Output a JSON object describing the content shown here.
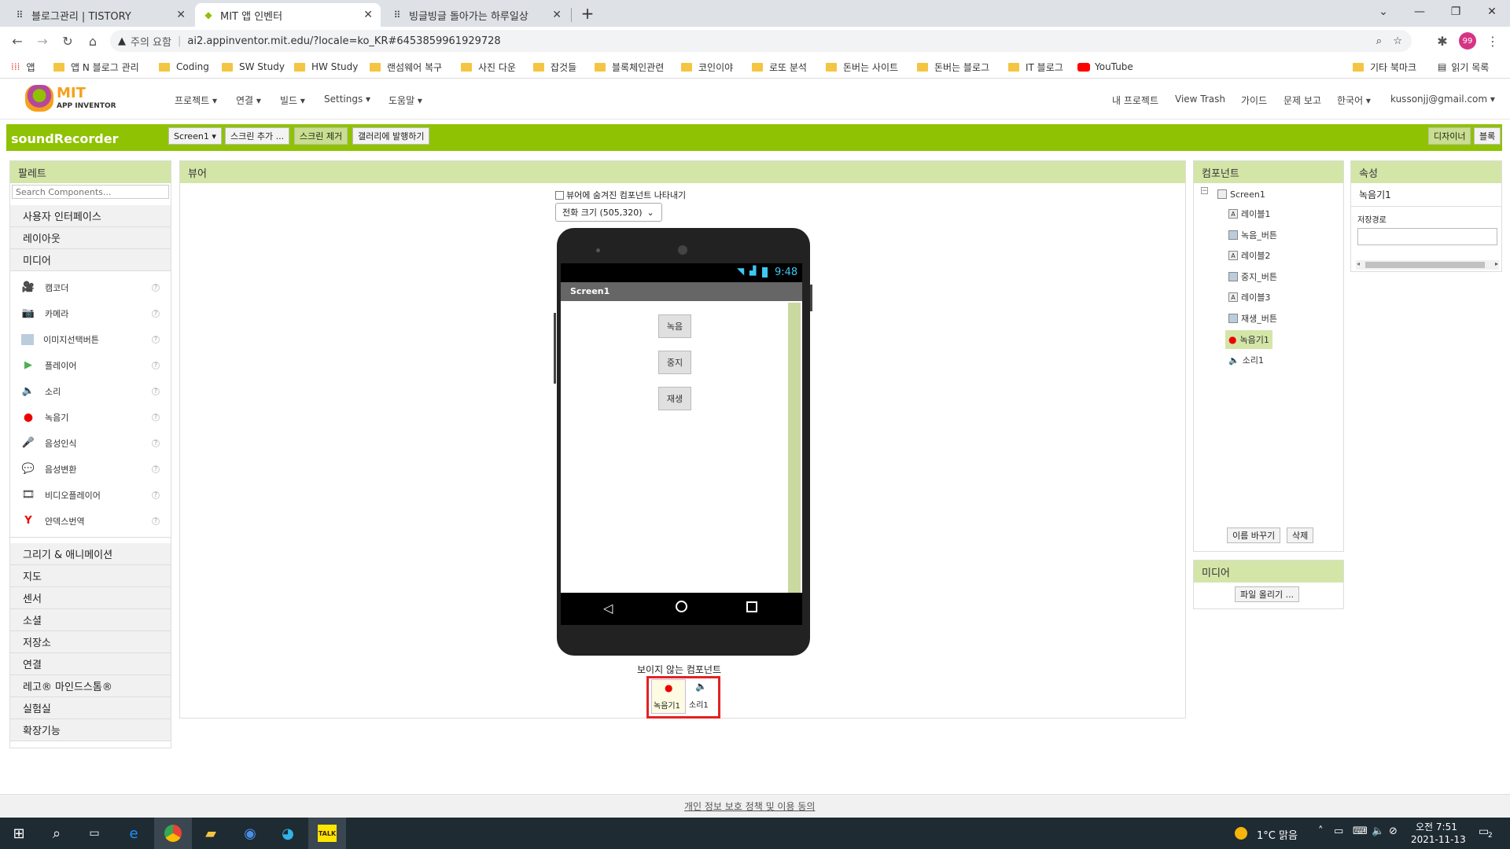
{
  "browser": {
    "tabs": [
      {
        "title": "블로그관리 | TISTORY",
        "active": false
      },
      {
        "title": "MIT 앱 인벤터",
        "active": true
      },
      {
        "title": "빙글빙글 돌아가는 하루일상",
        "active": false
      }
    ],
    "security_label": "주의 요함",
    "url": "ai2.appinventor.mit.edu/?locale=ko_KR#6453859961929728",
    "profile_initials": "99",
    "bookmarks": [
      "앱",
      "앱 N 블로그 관리",
      "Coding",
      "SW Study",
      "HW Study",
      "랜섬웨어 복구",
      "사진 다운",
      "잡것들",
      "블록체인관련",
      "코인이야",
      "로또 분석",
      "돈버는 사이트",
      "돈버는 블로그",
      "IT 블로그",
      "YouTube"
    ],
    "bookmarks_right": [
      "기타 북마크",
      "읽기 목록"
    ]
  },
  "app": {
    "logo_title": "MIT",
    "logo_sub": "APP INVENTOR",
    "menus": [
      "프로젝트 ▾",
      "연결 ▾",
      "빌드 ▾",
      "Settings ▾",
      "도움말 ▾"
    ],
    "right_menus": [
      "내 프로젝트",
      "View Trash",
      "가이드",
      "문제 보고",
      "한국어 ▾",
      "kussonjj@gmail.com ▾"
    ],
    "project_name": "soundRecorder",
    "toolbar": {
      "screen_select": "Screen1 ▾",
      "add_screen": "스크린 추가 ...",
      "remove_screen": "스크린 제거",
      "publish": "갤러리에 발행하기",
      "designer": "디자이너",
      "blocks": "블록"
    }
  },
  "palette": {
    "title": "팔레트",
    "search_placeholder": "Search Components...",
    "categories_top": [
      "사용자 인터페이스",
      "레이아웃",
      "미디어"
    ],
    "items": [
      "캠코더",
      "카메라",
      "이미지선택버튼",
      "플레이어",
      "소리",
      "녹음기",
      "음성인식",
      "음성변환",
      "비디오플레이어",
      "얀덱스번역"
    ],
    "categories_bottom": [
      "그리기 & 애니메이션",
      "지도",
      "센서",
      "소셜",
      "저장소",
      "연결",
      "레고® 마인드스톰®",
      "실험실",
      "확장기능"
    ]
  },
  "viewer": {
    "title": "뷰어",
    "show_hidden": "뷰어에 숨겨진 컴포넌트 나타내기",
    "size_select": "전화 크기 (505,320)",
    "status_time": "9:48",
    "screen_title": "Screen1",
    "buttons": [
      "녹음",
      "중지",
      "재생"
    ],
    "nonvisible_title": "보이지 않는 컴포넌트",
    "nonvisible": [
      "녹음기1",
      "소리1"
    ]
  },
  "components": {
    "title": "컴포넌트",
    "root": "Screen1",
    "children": [
      "레이블1",
      "녹음_버튼",
      "레이블2",
      "중지_버튼",
      "레이블3",
      "재생_버튼",
      "녹음기1",
      "소리1"
    ],
    "selected": "녹음기1",
    "rename": "이름 바꾸기",
    "delete": "삭제"
  },
  "media": {
    "title": "미디어",
    "upload": "파일 올리기 ..."
  },
  "properties": {
    "title": "속성",
    "component": "녹음기1",
    "field_label": "저장경로",
    "field_value": ""
  },
  "footer": {
    "privacy": "개인 정보 보호 정책 및 이용 동의"
  },
  "taskbar": {
    "weather": "1°C 맑음",
    "time": "오전 7:51",
    "date": "2021-11-13",
    "notif_count": "2"
  }
}
